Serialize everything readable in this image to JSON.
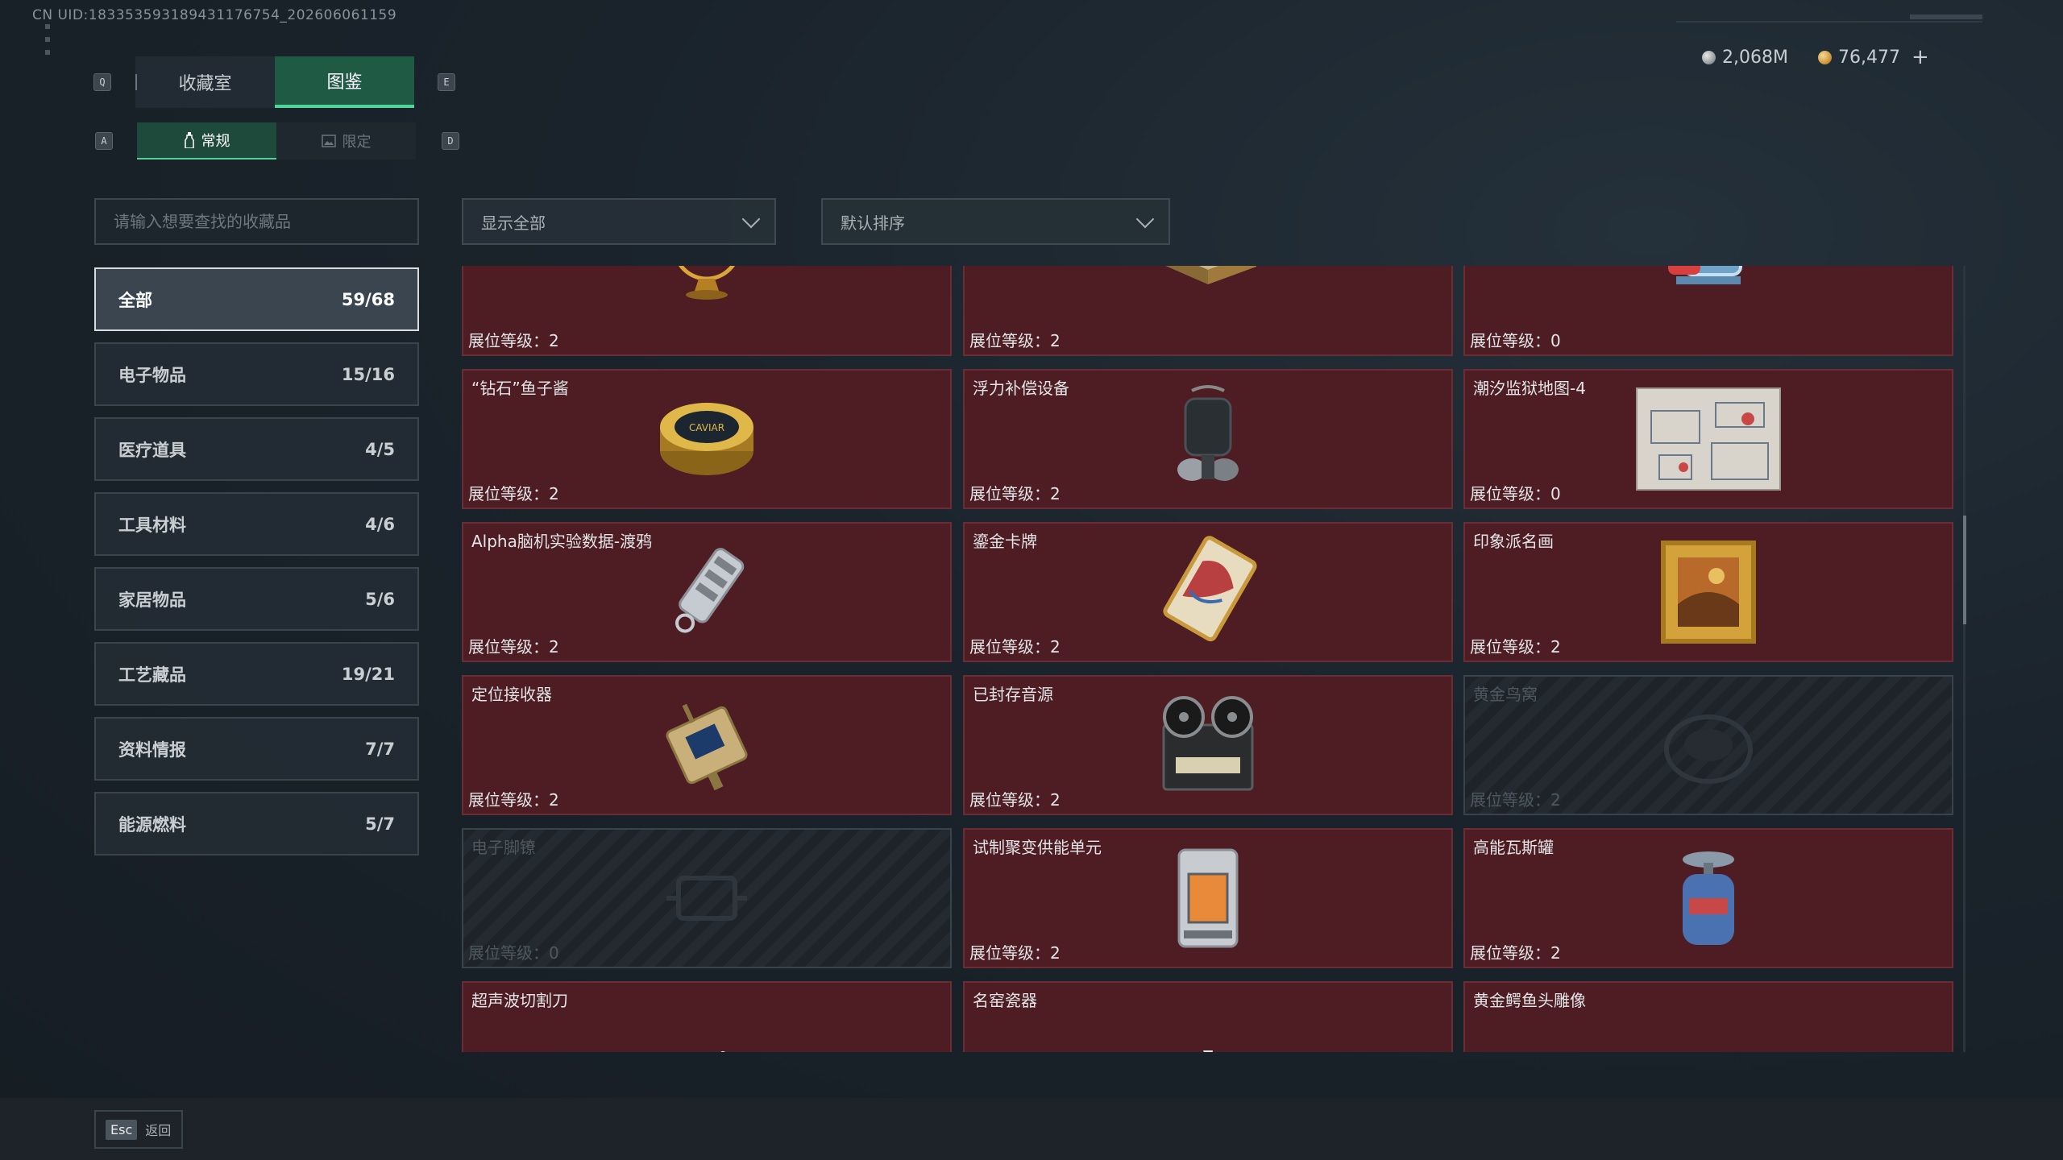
{
  "uid_text": "CN UID:183353593189431176754_202606061159",
  "currency": {
    "silver": "2,068M",
    "gold": "76,477",
    "add_symbol": "+"
  },
  "keys": {
    "q": "Q",
    "e": "E",
    "a": "A",
    "d": "D",
    "esc": "Esc"
  },
  "tabs": [
    {
      "label": "收藏室",
      "active": false
    },
    {
      "label": "图鉴",
      "active": true
    }
  ],
  "subtabs": [
    {
      "label": "常规",
      "icon": "bottle-icon",
      "active": true
    },
    {
      "label": "限定",
      "icon": "image-icon",
      "active": false
    }
  ],
  "search": {
    "placeholder": "请输入想要查找的收藏品"
  },
  "filters": {
    "show": "显示全部",
    "sort": "默认排序"
  },
  "categories": [
    {
      "name": "全部",
      "count": "59/68",
      "active": true
    },
    {
      "name": "电子物品",
      "count": "15/16",
      "active": false
    },
    {
      "name": "医疗道具",
      "count": "4/5",
      "active": false
    },
    {
      "name": "工具材料",
      "count": "4/6",
      "active": false
    },
    {
      "name": "家居物品",
      "count": "5/6",
      "active": false
    },
    {
      "name": "工艺藏品",
      "count": "19/21",
      "active": false
    },
    {
      "name": "资料情报",
      "count": "7/7",
      "active": false
    },
    {
      "name": "能源燃料",
      "count": "5/7",
      "active": false
    }
  ],
  "level_prefix": "展位等级：",
  "items": [
    {
      "name": "",
      "level": "2",
      "locked": false,
      "icon": "armillary-sphere-icon"
    },
    {
      "name": "",
      "level": "2",
      "locked": false,
      "icon": "chess-box-icon"
    },
    {
      "name": "",
      "level": "0",
      "locked": false,
      "icon": "robot-device-icon"
    },
    {
      "name": "“钻石”鱼子酱",
      "level": "2",
      "locked": false,
      "icon": "caviar-tin-icon"
    },
    {
      "name": "浮力补偿设备",
      "level": "2",
      "locked": false,
      "icon": "dive-gear-icon"
    },
    {
      "name": "潮汐监狱地图-4",
      "level": "0",
      "locked": false,
      "icon": "map-icon"
    },
    {
      "name": "Alpha脑机实验数据-渡鸦",
      "level": "2",
      "locked": false,
      "icon": "data-drive-icon"
    },
    {
      "name": "鎏金卡牌",
      "level": "2",
      "locked": false,
      "icon": "gold-card-icon"
    },
    {
      "name": "印象派名画",
      "level": "2",
      "locked": false,
      "icon": "painting-icon"
    },
    {
      "name": "定位接收器",
      "level": "2",
      "locked": false,
      "icon": "receiver-icon"
    },
    {
      "name": "已封存音源",
      "level": "2",
      "locked": false,
      "icon": "tape-recorder-icon"
    },
    {
      "name": "黄金鸟窝",
      "level": "2",
      "locked": true,
      "icon": "bird-nest-icon"
    },
    {
      "name": "电子脚镣",
      "level": "0",
      "locked": true,
      "icon": "ankle-monitor-icon"
    },
    {
      "name": "试制聚变供能单元",
      "level": "2",
      "locked": false,
      "icon": "fusion-cell-icon"
    },
    {
      "name": "高能瓦斯罐",
      "level": "2",
      "locked": false,
      "icon": "gas-canister-icon"
    },
    {
      "name": "超声波切割刀",
      "level": "",
      "locked": false,
      "icon": "cutter-icon"
    },
    {
      "name": "名窑瓷器",
      "level": "",
      "locked": false,
      "icon": "porcelain-icon"
    },
    {
      "name": "黄金鳄鱼头雕像",
      "level": "",
      "locked": false,
      "icon": "croc-statue-icon"
    }
  ],
  "back_label": "返回"
}
